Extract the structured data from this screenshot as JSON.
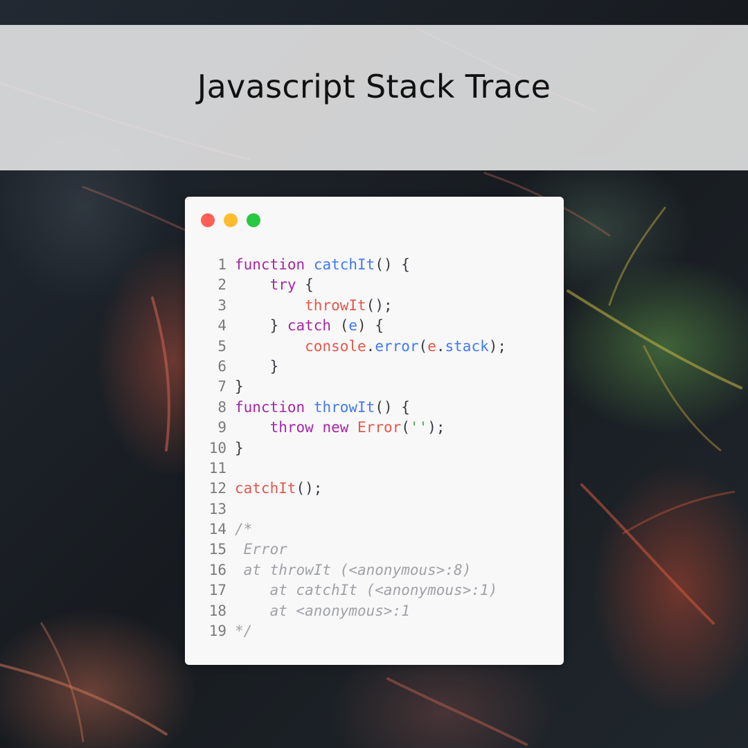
{
  "title": "Javascript Stack Trace",
  "window": {
    "controls": [
      {
        "name": "close",
        "color": "#ff5f56"
      },
      {
        "name": "minimize",
        "color": "#ffbd2e"
      },
      {
        "name": "maximize",
        "color": "#27c93f"
      }
    ]
  },
  "code": {
    "lines": [
      {
        "n": "1",
        "tokens": [
          {
            "t": "function",
            "c": "kw"
          },
          {
            "t": " ",
            "c": "pl"
          },
          {
            "t": "catchIt",
            "c": "fn"
          },
          {
            "t": "() {",
            "c": "pl"
          }
        ]
      },
      {
        "n": "2",
        "tokens": [
          {
            "t": "    ",
            "c": "pl"
          },
          {
            "t": "try",
            "c": "kw"
          },
          {
            "t": " {",
            "c": "pl"
          }
        ]
      },
      {
        "n": "3",
        "tokens": [
          {
            "t": "        ",
            "c": "pl"
          },
          {
            "t": "throwIt",
            "c": "ca"
          },
          {
            "t": "();",
            "c": "pl"
          }
        ]
      },
      {
        "n": "4",
        "tokens": [
          {
            "t": "    } ",
            "c": "pl"
          },
          {
            "t": "catch",
            "c": "kw"
          },
          {
            "t": " (",
            "c": "pl"
          },
          {
            "t": "e",
            "c": "fn"
          },
          {
            "t": ") {",
            "c": "pl"
          }
        ]
      },
      {
        "n": "5",
        "tokens": [
          {
            "t": "        ",
            "c": "pl"
          },
          {
            "t": "console",
            "c": "ca"
          },
          {
            "t": ".",
            "c": "pl"
          },
          {
            "t": "error",
            "c": "fn"
          },
          {
            "t": "(",
            "c": "pl"
          },
          {
            "t": "e",
            "c": "ca"
          },
          {
            "t": ".",
            "c": "pl"
          },
          {
            "t": "stack",
            "c": "fn"
          },
          {
            "t": ");",
            "c": "pl"
          }
        ]
      },
      {
        "n": "6",
        "tokens": [
          {
            "t": "    }",
            "c": "pl"
          }
        ]
      },
      {
        "n": "7",
        "tokens": [
          {
            "t": "}",
            "c": "pl"
          }
        ]
      },
      {
        "n": "8",
        "tokens": [
          {
            "t": "function",
            "c": "kw"
          },
          {
            "t": " ",
            "c": "pl"
          },
          {
            "t": "throwIt",
            "c": "fn"
          },
          {
            "t": "() {",
            "c": "pl"
          }
        ]
      },
      {
        "n": "9",
        "tokens": [
          {
            "t": "    ",
            "c": "pl"
          },
          {
            "t": "throw",
            "c": "kw"
          },
          {
            "t": " ",
            "c": "pl"
          },
          {
            "t": "new",
            "c": "kw"
          },
          {
            "t": " ",
            "c": "pl"
          },
          {
            "t": "Error",
            "c": "ca"
          },
          {
            "t": "(",
            "c": "pl"
          },
          {
            "t": "''",
            "c": "str"
          },
          {
            "t": ");",
            "c": "pl"
          }
        ]
      },
      {
        "n": "10",
        "tokens": [
          {
            "t": "}",
            "c": "pl"
          }
        ]
      },
      {
        "n": "11",
        "tokens": []
      },
      {
        "n": "12",
        "tokens": [
          {
            "t": "catchIt",
            "c": "ca"
          },
          {
            "t": "();",
            "c": "pl"
          }
        ]
      },
      {
        "n": "13",
        "tokens": []
      },
      {
        "n": "14",
        "tokens": [
          {
            "t": "/*",
            "c": "cm"
          }
        ]
      },
      {
        "n": "15",
        "tokens": [
          {
            "t": " Error",
            "c": "cm"
          }
        ]
      },
      {
        "n": "16",
        "tokens": [
          {
            "t": " at throwIt (<anonymous>:8)",
            "c": "cm"
          }
        ]
      },
      {
        "n": "17",
        "tokens": [
          {
            "t": "    at catchIt (<anonymous>:1)",
            "c": "cm"
          }
        ]
      },
      {
        "n": "18",
        "tokens": [
          {
            "t": "    at <anonymous>:1",
            "c": "cm"
          }
        ]
      },
      {
        "n": "19",
        "tokens": [
          {
            "t": "*/",
            "c": "cm"
          }
        ]
      }
    ]
  }
}
